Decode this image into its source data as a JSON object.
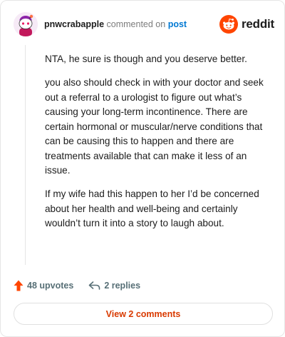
{
  "header": {
    "username": "pnwcrabapple",
    "commented_text": "commented on",
    "post_link": "post",
    "brand": "reddit",
    "brand_color": "#ff4500"
  },
  "comment": {
    "paragraphs": [
      "NTA, he sure is though and you deserve better.",
      "you also should check in with your doctor and seek out a referral to a urologist to figure out what’s causing your long-term incontinence. There are certain hormonal or muscular/nerve conditions that can be causing this to happen and there are treatments available that can make it less of an issue.",
      "If my wife had this happen to her I’d be concerned about her health and well-being and certainly wouldn’t turn it into a story to laugh about."
    ]
  },
  "actions": {
    "upvotes": "48 upvotes",
    "replies": "2 replies"
  },
  "footer": {
    "view_comments": "View 2 comments",
    "accent": "#d93a00"
  },
  "icons": {
    "avatar": "snoo-avatar",
    "upvote": "upvote-arrow-icon",
    "reply": "reply-arrow-icon",
    "logo": "reddit-snoo-logo"
  }
}
